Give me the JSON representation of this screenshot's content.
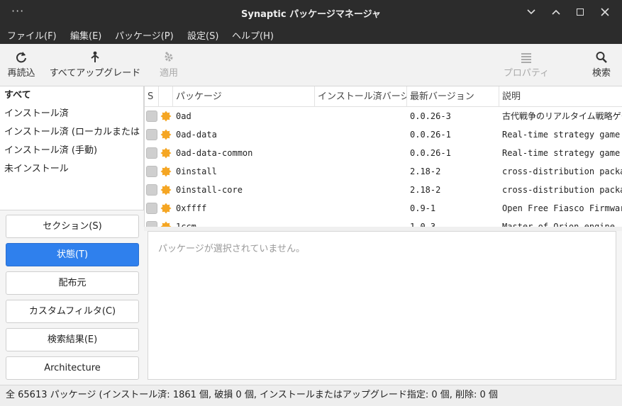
{
  "window": {
    "title": "Synaptic パッケージマネージャ",
    "menu_dots": "···"
  },
  "menubar": {
    "items": [
      "ファイル(F)",
      "編集(E)",
      "パッケージ(P)",
      "設定(S)",
      "ヘルプ(H)"
    ]
  },
  "toolbar": {
    "reload": "再読込",
    "upgrade_all": "すべてアップグレード",
    "apply": "適用",
    "properties": "プロパティ",
    "search": "検索"
  },
  "filters": {
    "items": [
      "すべて",
      "インストール済",
      "インストール済 (ローカルまたは",
      "インストール済 (手動)",
      "未インストール"
    ],
    "selected": 0
  },
  "sidebar_buttons": {
    "sections": "セクション(S)",
    "status": "状態(T)",
    "origin": "配布元",
    "custom_filter": "カスタムフィルタ(C)",
    "search_results": "検索結果(E)",
    "architecture": "Architecture",
    "active": "status"
  },
  "table": {
    "columns": {
      "s": "S",
      "package": "パッケージ",
      "installed_version": "インストール済バージョン",
      "latest_version": "最新バージョン",
      "description": "説明"
    },
    "rows": [
      {
        "package": "0ad",
        "latest": "0.0.26-3",
        "desc": "古代戦争のリアルタイム戦略ゲーム"
      },
      {
        "package": "0ad-data",
        "latest": "0.0.26-1",
        "desc": "Real-time strategy game"
      },
      {
        "package": "0ad-data-common",
        "latest": "0.0.26-1",
        "desc": "Real-time strategy game"
      },
      {
        "package": "0install",
        "latest": "2.18-2",
        "desc": "cross-distribution packaging"
      },
      {
        "package": "0install-core",
        "latest": "2.18-2",
        "desc": "cross-distribution packaging"
      },
      {
        "package": "0xffff",
        "latest": "0.9-1",
        "desc": "Open Free Fiasco Firmware"
      },
      {
        "package": "1ccm",
        "latest": "1.0.3",
        "desc": "Master of Orion engine"
      }
    ]
  },
  "details": {
    "empty_message": "パッケージが選択されていません。"
  },
  "statusbar": {
    "text": "全 65613 パッケージ (インストール済: 1861 個, 破損 0 個, インストールまたはアップグレード指定: 0 個, 削除: 0 個"
  },
  "colors": {
    "active_button": "#2f80ed",
    "titlebar": "#2c2c2c",
    "star_icon": "#f5a623"
  }
}
